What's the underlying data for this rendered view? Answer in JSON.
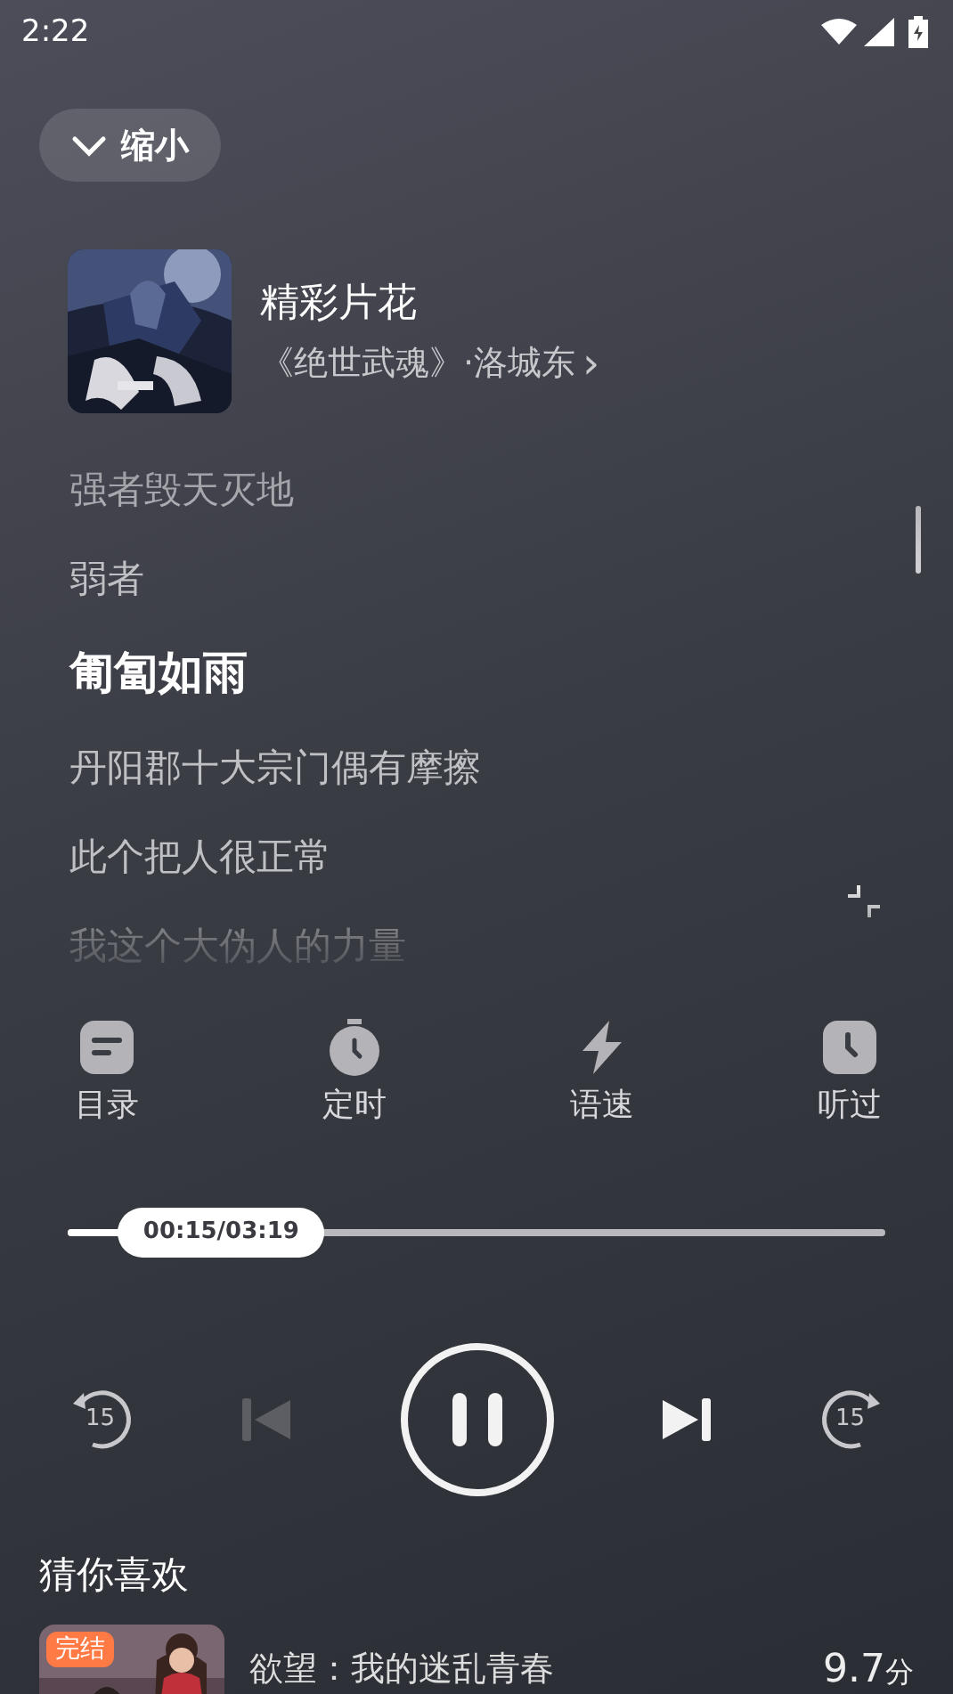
{
  "status_bar": {
    "time": "2:22"
  },
  "collapse_button": {
    "label": "缩小"
  },
  "now_playing": {
    "title": "精彩片花",
    "subtitle": "《绝世武魂》·洛城东",
    "chevron": "›"
  },
  "lyrics": [
    {
      "text": "强者毁天灭地",
      "current": false
    },
    {
      "text": "弱者",
      "current": false
    },
    {
      "text": "匍匐如雨",
      "current": true
    },
    {
      "text": "丹阳郡十大宗门偶有摩擦",
      "current": false
    },
    {
      "text": "此个把人很正常",
      "current": false
    },
    {
      "text": "我这个大伪人的力量",
      "current": false
    }
  ],
  "actions": [
    {
      "kind": "catalog",
      "label": "目录"
    },
    {
      "kind": "timer",
      "label": "定时"
    },
    {
      "kind": "speed",
      "label": "语速"
    },
    {
      "kind": "history",
      "label": "听过"
    }
  ],
  "progress": {
    "level": 0.075,
    "time": "00:15/03:19"
  },
  "controls": [
    {
      "kind": "rewind",
      "label": "15",
      "disabled": false
    },
    {
      "kind": "prev",
      "disabled": true
    },
    {
      "kind": "pause",
      "disabled": false
    },
    {
      "kind": "next",
      "disabled": false
    },
    {
      "kind": "forward",
      "label": "15",
      "disabled": false
    }
  ],
  "recommendations": {
    "title": "猜你喜欢",
    "items": [
      {
        "badge": "完结",
        "title": "欲望：我的迷乱青春",
        "score": "9.7",
        "unit": "分"
      }
    ]
  }
}
